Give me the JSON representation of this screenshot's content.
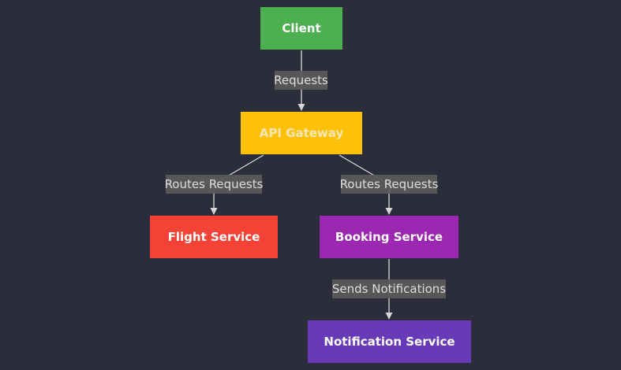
{
  "colors": {
    "background": "#2b2e3a",
    "edge": "#d8d8d8",
    "label_bg": "#5a5a5a",
    "label_text": "#e6e6e6"
  },
  "nodes": {
    "client": {
      "label": "Client",
      "fill": "#4caf50",
      "text": "#ffffff"
    },
    "api_gateway": {
      "label": "API Gateway",
      "fill": "#ffc107",
      "text": "#f6e7b8"
    },
    "flight_service": {
      "label": "Flight Service",
      "fill": "#f44336",
      "text": "#ffffff"
    },
    "booking_service": {
      "label": "Booking Service",
      "fill": "#9c27b0",
      "text": "#ffffff"
    },
    "notification_service": {
      "label": "Notification Service",
      "fill": "#673ab7",
      "text": "#ffffff"
    }
  },
  "edges": {
    "client_to_gateway": {
      "label": "Requests"
    },
    "gateway_to_flight": {
      "label": "Routes Requests"
    },
    "gateway_to_booking": {
      "label": "Routes Requests"
    },
    "booking_to_notification": {
      "label": "Sends Notifications"
    }
  }
}
